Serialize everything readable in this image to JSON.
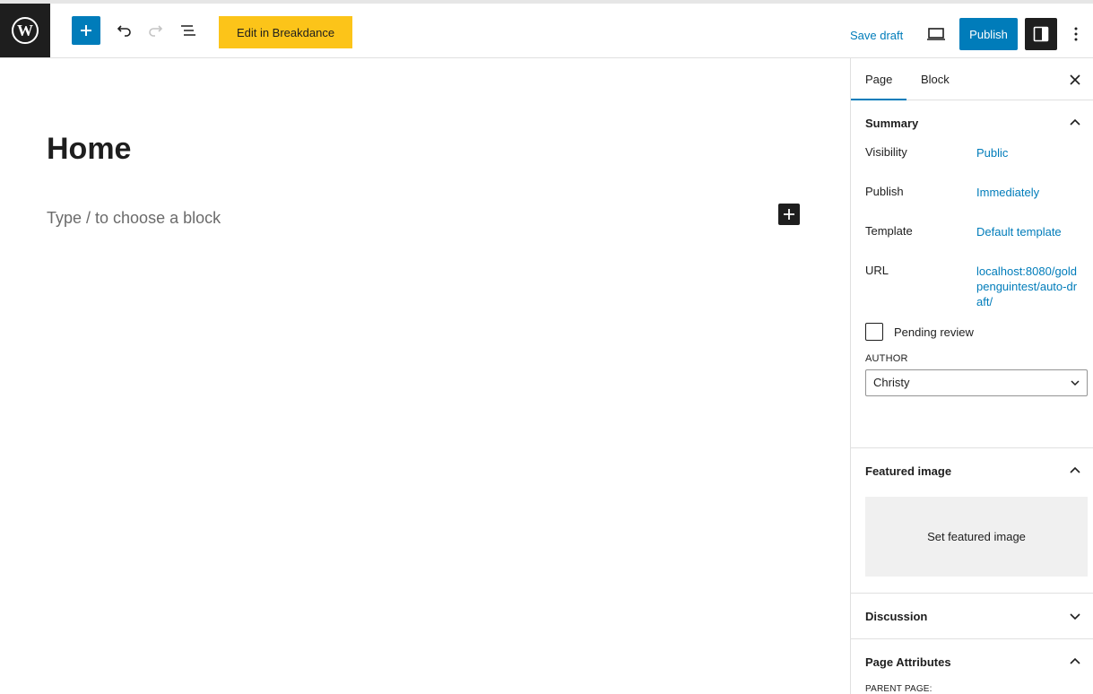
{
  "toolbar": {
    "logo_icon": "wordpress-logo-icon",
    "breakdance_label": "Edit in Breakdance",
    "save_draft_label": "Save draft",
    "publish_label": "Publish",
    "accent": "#007cba",
    "breakdance_color": "#fcc419"
  },
  "editor": {
    "title": "Home",
    "placeholder": "Type / to choose a block"
  },
  "sidebar": {
    "tabs": [
      {
        "label": "Page",
        "active": true
      },
      {
        "label": "Block",
        "active": false
      }
    ],
    "summary": {
      "title": "Summary",
      "rows": [
        {
          "label": "Visibility",
          "value": "Public"
        },
        {
          "label": "Publish",
          "value": "Immediately"
        },
        {
          "label": "Template",
          "value": "Default template"
        },
        {
          "label": "URL",
          "value": "localhost:8080/goldpenguintest/auto-draft/"
        }
      ],
      "pending_review": "Pending review",
      "author_label": "AUTHOR",
      "author_value": "Christy"
    },
    "featured_image": {
      "title": "Featured image",
      "button": "Set featured image"
    },
    "discussion": {
      "title": "Discussion"
    },
    "page_attributes": {
      "title": "Page Attributes",
      "parent_label": "PARENT PAGE:"
    }
  }
}
